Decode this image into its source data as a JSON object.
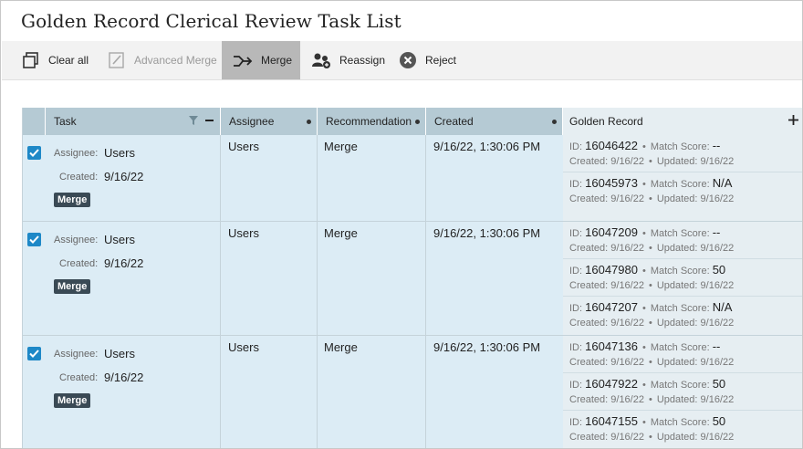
{
  "page": {
    "title": "Golden Record Clerical Review Task List"
  },
  "toolbar": {
    "clear_all": "Clear all",
    "advanced_merge": "Advanced Merge",
    "merge": "Merge",
    "reassign": "Reassign",
    "reject": "Reject"
  },
  "columns": {
    "task": "Task",
    "assignee": "Assignee",
    "recommendation": "Recommendation",
    "created": "Created",
    "golden_record": "Golden Record"
  },
  "labels": {
    "assignee": "Assignee:",
    "created": "Created:",
    "id": "ID:",
    "match_score": "Match Score:",
    "created_short": "Created:",
    "updated": "Updated:",
    "bullet": "•"
  },
  "rows": [
    {
      "assignee": "Users",
      "created_date": "9/16/22",
      "badge": "Merge",
      "assignee_col": "Users",
      "recommendation": "Merge",
      "created_col": "9/16/22, 1:30:06 PM",
      "records": [
        {
          "id": "16046422",
          "score": "--",
          "created": "9/16/22",
          "updated": "9/16/22"
        },
        {
          "id": "16045973",
          "score": "N/A",
          "created": "9/16/22",
          "updated": "9/16/22"
        }
      ]
    },
    {
      "assignee": "Users",
      "created_date": "9/16/22",
      "badge": "Merge",
      "assignee_col": "Users",
      "recommendation": "Merge",
      "created_col": "9/16/22, 1:30:06 PM",
      "records": [
        {
          "id": "16047209",
          "score": "--",
          "created": "9/16/22",
          "updated": "9/16/22"
        },
        {
          "id": "16047980",
          "score": "50",
          "created": "9/16/22",
          "updated": "9/16/22"
        },
        {
          "id": "16047207",
          "score": "N/A",
          "created": "9/16/22",
          "updated": "9/16/22"
        }
      ]
    },
    {
      "assignee": "Users",
      "created_date": "9/16/22",
      "badge": "Merge",
      "assignee_col": "Users",
      "recommendation": "Merge",
      "created_col": "9/16/22, 1:30:06 PM",
      "records": [
        {
          "id": "16047136",
          "score": "--",
          "created": "9/16/22",
          "updated": "9/16/22"
        },
        {
          "id": "16047922",
          "score": "50",
          "created": "9/16/22",
          "updated": "9/16/22"
        },
        {
          "id": "16047155",
          "score": "50",
          "created": "9/16/22",
          "updated": "9/16/22"
        }
      ]
    }
  ]
}
